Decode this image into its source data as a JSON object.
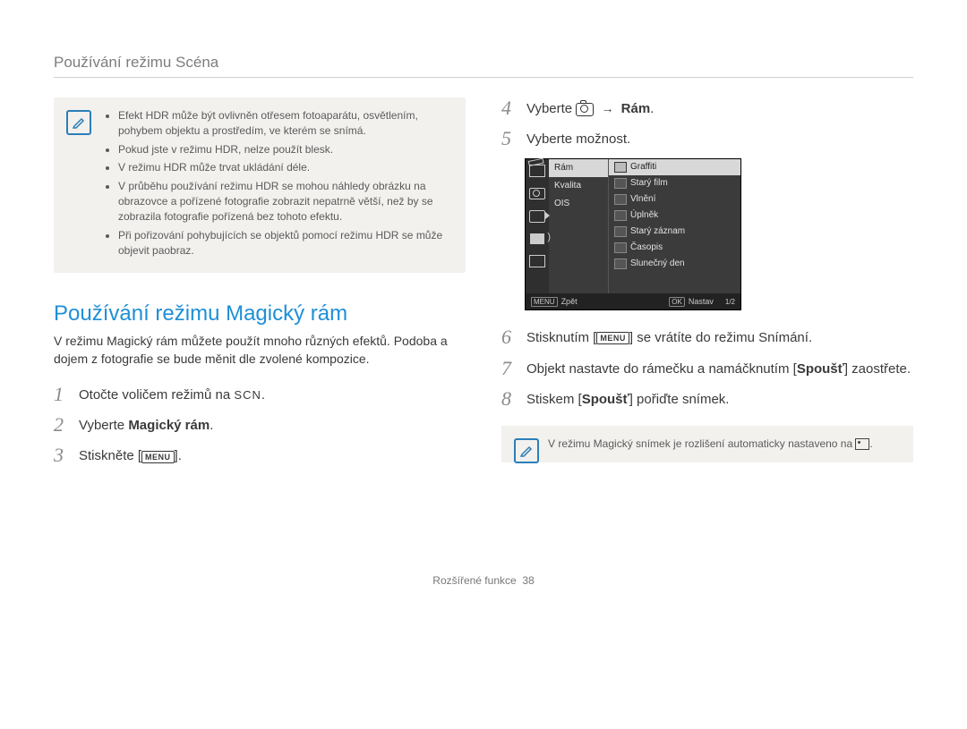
{
  "header": "Používání režimu Scéna",
  "notes_left": [
    "Efekt HDR může být ovlivněn otřesem fotoaparátu, osvětlením, pohybem objektu a prostředím, ve kterém se snímá.",
    "Pokud jste v režimu HDR, nelze použít blesk.",
    "V režimu HDR může trvat ukládání déle.",
    "V průběhu používání režimu HDR se mohou náhledy obrázku na obrazovce a pořízené fotografie zobrazit nepatrně větší, než by se zobrazila fotografie pořízená bez tohoto efektu.",
    "Při pořizování pohybujících se objektů pomocí režimu HDR se může objevit paobraz."
  ],
  "section_title": "Používání režimu Magický rám",
  "section_body": "V režimu Magický rám můžete použít mnoho různých efektů. Podoba a dojem z fotografie se bude měnit dle zvolené kompozice.",
  "steps_left": [
    {
      "n": "1",
      "pre": "Otočte voličem režimů na ",
      "scn": "SCN",
      "post": "."
    },
    {
      "n": "2",
      "pre": "Vyberte ",
      "b": "Magický rám",
      "post": "."
    },
    {
      "n": "3",
      "pre": "Stiskněte [",
      "menu": "MENU",
      "post": "]."
    }
  ],
  "steps_right_a": [
    {
      "n": "4",
      "pre": "Vyberte ",
      "cam": true,
      "arrow": "→",
      "b": "Rám",
      "post": "."
    },
    {
      "n": "5",
      "pre": "Vyberte možnost.",
      "post": ""
    }
  ],
  "lcd": {
    "mid": [
      {
        "t": "Rám",
        "sel": true
      },
      {
        "t": "Kvalita"
      },
      {
        "t": "OIS"
      }
    ],
    "right": [
      {
        "t": "Graffiti",
        "sel": true
      },
      {
        "t": "Starý film"
      },
      {
        "t": "Vlnění"
      },
      {
        "t": "Úplněk"
      },
      {
        "t": "Starý záznam"
      },
      {
        "t": "Časopis"
      },
      {
        "t": "Slunečný den"
      }
    ],
    "back": "Zpět",
    "set": "Nastav",
    "page": "1/2",
    "menu": "MENU",
    "ok": "OK"
  },
  "steps_right_b": [
    {
      "n": "6",
      "pre": "Stisknutím [",
      "menu": "MENU",
      "post": "] se vrátíte do režimu Snímání."
    },
    {
      "n": "7",
      "pre": "Objekt nastavte do rámečku a namáčknutím [",
      "b": "Spoušť",
      "post": "] zaostřete."
    },
    {
      "n": "8",
      "pre": "Stiskem [",
      "b": "Spoušť",
      "post": "] pořiďte snímek."
    }
  ],
  "note_right": "V režimu Magický snímek je rozlišení automaticky nastaveno na ",
  "footer_label": "Rozšířené funkce",
  "footer_page": "38"
}
